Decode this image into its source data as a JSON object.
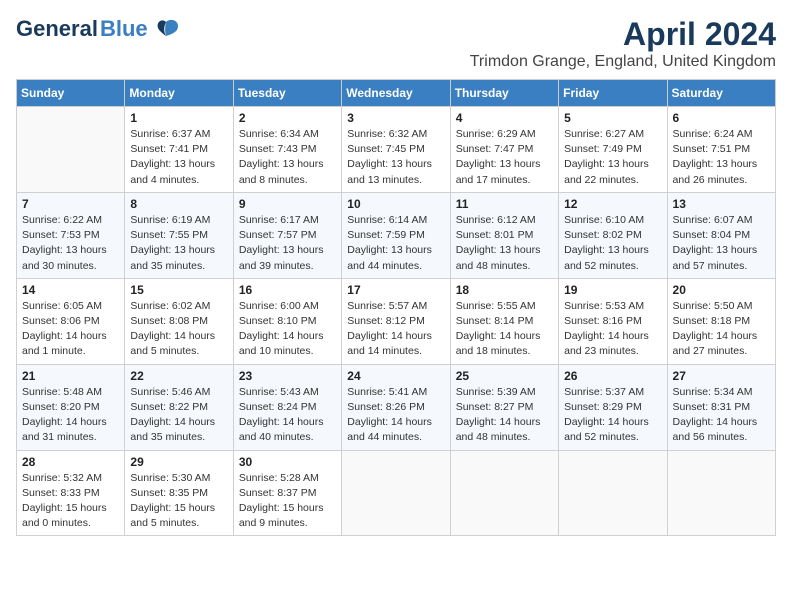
{
  "header": {
    "logo_general": "General",
    "logo_blue": "Blue",
    "title": "April 2024",
    "location": "Trimdon Grange, England, United Kingdom"
  },
  "days_of_week": [
    "Sunday",
    "Monday",
    "Tuesday",
    "Wednesday",
    "Thursday",
    "Friday",
    "Saturday"
  ],
  "weeks": [
    [
      {
        "day": "",
        "content": ""
      },
      {
        "day": "1",
        "content": "Sunrise: 6:37 AM\nSunset: 7:41 PM\nDaylight: 13 hours\nand 4 minutes."
      },
      {
        "day": "2",
        "content": "Sunrise: 6:34 AM\nSunset: 7:43 PM\nDaylight: 13 hours\nand 8 minutes."
      },
      {
        "day": "3",
        "content": "Sunrise: 6:32 AM\nSunset: 7:45 PM\nDaylight: 13 hours\nand 13 minutes."
      },
      {
        "day": "4",
        "content": "Sunrise: 6:29 AM\nSunset: 7:47 PM\nDaylight: 13 hours\nand 17 minutes."
      },
      {
        "day": "5",
        "content": "Sunrise: 6:27 AM\nSunset: 7:49 PM\nDaylight: 13 hours\nand 22 minutes."
      },
      {
        "day": "6",
        "content": "Sunrise: 6:24 AM\nSunset: 7:51 PM\nDaylight: 13 hours\nand 26 minutes."
      }
    ],
    [
      {
        "day": "7",
        "content": "Sunrise: 6:22 AM\nSunset: 7:53 PM\nDaylight: 13 hours\nand 30 minutes."
      },
      {
        "day": "8",
        "content": "Sunrise: 6:19 AM\nSunset: 7:55 PM\nDaylight: 13 hours\nand 35 minutes."
      },
      {
        "day": "9",
        "content": "Sunrise: 6:17 AM\nSunset: 7:57 PM\nDaylight: 13 hours\nand 39 minutes."
      },
      {
        "day": "10",
        "content": "Sunrise: 6:14 AM\nSunset: 7:59 PM\nDaylight: 13 hours\nand 44 minutes."
      },
      {
        "day": "11",
        "content": "Sunrise: 6:12 AM\nSunset: 8:01 PM\nDaylight: 13 hours\nand 48 minutes."
      },
      {
        "day": "12",
        "content": "Sunrise: 6:10 AM\nSunset: 8:02 PM\nDaylight: 13 hours\nand 52 minutes."
      },
      {
        "day": "13",
        "content": "Sunrise: 6:07 AM\nSunset: 8:04 PM\nDaylight: 13 hours\nand 57 minutes."
      }
    ],
    [
      {
        "day": "14",
        "content": "Sunrise: 6:05 AM\nSunset: 8:06 PM\nDaylight: 14 hours\nand 1 minute."
      },
      {
        "day": "15",
        "content": "Sunrise: 6:02 AM\nSunset: 8:08 PM\nDaylight: 14 hours\nand 5 minutes."
      },
      {
        "day": "16",
        "content": "Sunrise: 6:00 AM\nSunset: 8:10 PM\nDaylight: 14 hours\nand 10 minutes."
      },
      {
        "day": "17",
        "content": "Sunrise: 5:57 AM\nSunset: 8:12 PM\nDaylight: 14 hours\nand 14 minutes."
      },
      {
        "day": "18",
        "content": "Sunrise: 5:55 AM\nSunset: 8:14 PM\nDaylight: 14 hours\nand 18 minutes."
      },
      {
        "day": "19",
        "content": "Sunrise: 5:53 AM\nSunset: 8:16 PM\nDaylight: 14 hours\nand 23 minutes."
      },
      {
        "day": "20",
        "content": "Sunrise: 5:50 AM\nSunset: 8:18 PM\nDaylight: 14 hours\nand 27 minutes."
      }
    ],
    [
      {
        "day": "21",
        "content": "Sunrise: 5:48 AM\nSunset: 8:20 PM\nDaylight: 14 hours\nand 31 minutes."
      },
      {
        "day": "22",
        "content": "Sunrise: 5:46 AM\nSunset: 8:22 PM\nDaylight: 14 hours\nand 35 minutes."
      },
      {
        "day": "23",
        "content": "Sunrise: 5:43 AM\nSunset: 8:24 PM\nDaylight: 14 hours\nand 40 minutes."
      },
      {
        "day": "24",
        "content": "Sunrise: 5:41 AM\nSunset: 8:26 PM\nDaylight: 14 hours\nand 44 minutes."
      },
      {
        "day": "25",
        "content": "Sunrise: 5:39 AM\nSunset: 8:27 PM\nDaylight: 14 hours\nand 48 minutes."
      },
      {
        "day": "26",
        "content": "Sunrise: 5:37 AM\nSunset: 8:29 PM\nDaylight: 14 hours\nand 52 minutes."
      },
      {
        "day": "27",
        "content": "Sunrise: 5:34 AM\nSunset: 8:31 PM\nDaylight: 14 hours\nand 56 minutes."
      }
    ],
    [
      {
        "day": "28",
        "content": "Sunrise: 5:32 AM\nSunset: 8:33 PM\nDaylight: 15 hours\nand 0 minutes."
      },
      {
        "day": "29",
        "content": "Sunrise: 5:30 AM\nSunset: 8:35 PM\nDaylight: 15 hours\nand 5 minutes."
      },
      {
        "day": "30",
        "content": "Sunrise: 5:28 AM\nSunset: 8:37 PM\nDaylight: 15 hours\nand 9 minutes."
      },
      {
        "day": "",
        "content": ""
      },
      {
        "day": "",
        "content": ""
      },
      {
        "day": "",
        "content": ""
      },
      {
        "day": "",
        "content": ""
      }
    ]
  ]
}
